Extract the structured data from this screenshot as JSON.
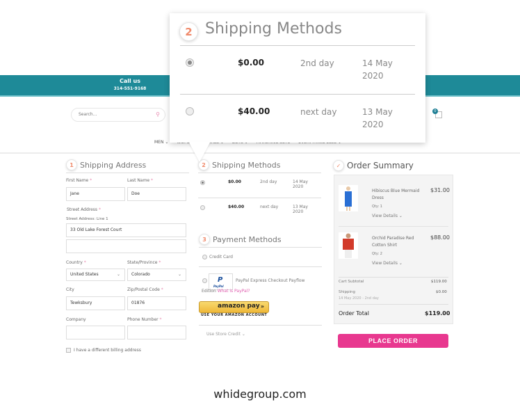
{
  "header": {
    "call_us_title": "Call us",
    "call_us_phone": "314-551-9168",
    "search_placeholder": "Search...",
    "cart_count": "0",
    "nav": [
      "MEN ⌄",
      "WOMEN ⌄",
      "GIRLS ⌄",
      "BOYS ⌄",
      "MATCHING SETS",
      "EVERYTHING ELSE ⌄"
    ]
  },
  "shipping_address": {
    "step": "1",
    "title": "Shipping Address",
    "first_name_label": "First Name",
    "first_name": "Jane",
    "last_name_label": "Last Name",
    "last_name": "Doe",
    "street_label": "Street Address",
    "street_line1_label": "Street Address: Line 1",
    "street_line1": "33 Old Lake Forest Court",
    "street_line2": "",
    "country_label": "Country",
    "country": "United States",
    "state_label": "State/Province",
    "state": "Colorado",
    "city_label": "City",
    "city": "Tewksbury",
    "zip_label": "Zip/Postal Code",
    "zip": "01876",
    "company_label": "Company",
    "company": "",
    "phone_label": "Phone Number",
    "phone": "",
    "billing_checkbox_label": "I have a different billing address",
    "required_mark": "*"
  },
  "shipping_methods": {
    "step": "2",
    "title": "Shipping Methods",
    "options": [
      {
        "price": "$0.00",
        "speed": "2nd day",
        "date_line1": "14 May",
        "date_line2": "2020",
        "selected": true
      },
      {
        "price": "$40.00",
        "speed": "next day",
        "date_line1": "13 May",
        "date_line2": "2020",
        "selected": false
      }
    ]
  },
  "payment_methods": {
    "step": "3",
    "title": "Payment Methods",
    "credit_card_label": "Credit Card",
    "paypal_label": "PayPal Express Checkout Payflow",
    "paypal_label_cont": "Edition",
    "paypal_link": "What is PayPal?",
    "paypal_logo_text": "PayPal",
    "amazon_button_text": "amazon pay",
    "amazon_arrows": "»",
    "amazon_sub": "USE YOUR AMAZON ACCOUNT",
    "store_credit_label": "Use Store Credit ⌄"
  },
  "order_summary": {
    "step_icon": "✓",
    "title": "Order Summary",
    "items": [
      {
        "name_line1": "Hibiscus Blue Mermaid",
        "name_line2": "Dress",
        "price": "$31.00",
        "qty": "Qty: 1",
        "details": "View Details ⌄"
      },
      {
        "name_line1": "Orchid Paradise Red",
        "name_line2": "Cotton Shirt",
        "price": "$88.00",
        "qty": "Qty: 2",
        "details": "View Details ⌄"
      }
    ],
    "subtotal_label": "Cart Subtotal",
    "subtotal": "$119.00",
    "shipping_label": "Shipping",
    "shipping_sub": "14 May 2020 - 2nd day",
    "shipping": "$0.00",
    "total_label": "Order Total",
    "total": "$119.00",
    "place_order": "PLACE ORDER"
  },
  "colors": {
    "teal": "#1e8a98",
    "pink": "#e8388f",
    "step_orange": "#f08a6b"
  },
  "footer": "whidegroup.com"
}
